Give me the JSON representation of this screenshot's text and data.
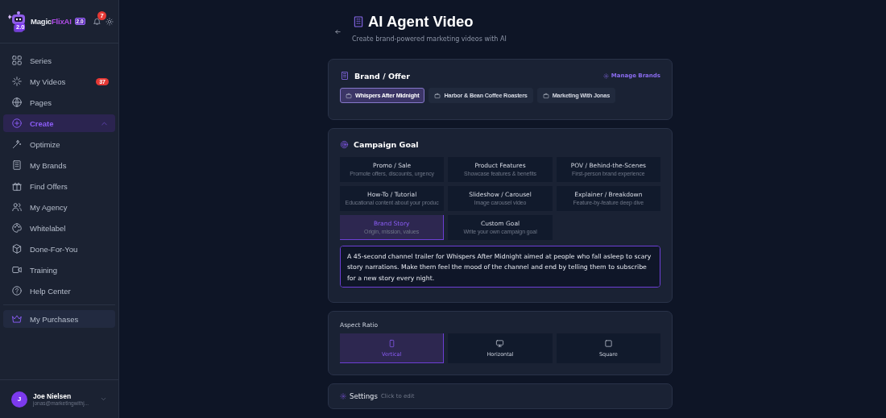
{
  "sidebar": {
    "logo": {
      "name_start": "Magic",
      "name_accent": "FlixAI",
      "version": "2.0",
      "robot_badge": "2.0"
    },
    "notification_count": "7",
    "items": [
      {
        "label": "Series",
        "selected": false
      },
      {
        "label": "My Videos",
        "selected": false,
        "badge": "37"
      },
      {
        "label": "Pages",
        "selected": false
      },
      {
        "label": "Create",
        "selected": true,
        "kind": "group",
        "expanded": true
      },
      {
        "label": "Optimize",
        "selected": false
      },
      {
        "label": "My Brands",
        "selected": false
      },
      {
        "label": "Find Offers",
        "selected": false
      },
      {
        "label": "My Agency",
        "selected": false
      },
      {
        "label": "Whitelabel",
        "selected": false
      },
      {
        "label": "Done-For-You",
        "selected": false
      },
      {
        "label": "Training",
        "selected": false
      },
      {
        "label": "Help Center",
        "selected": false
      }
    ],
    "purchases": {
      "label": "My Purchases"
    },
    "user": {
      "initial": "J",
      "name": "Joe Nielsen",
      "email": "jonas@marketingwithj..."
    }
  },
  "header": {
    "title": "AI Agent Video",
    "subtitle": "Create brand-powered marketing videos with AI"
  },
  "brand_card": {
    "title": "Brand / Offer",
    "action": "Manage Brands",
    "brands": [
      {
        "label": "Whispers After Midnight",
        "selected": true
      },
      {
        "label": "Harbor & Bean Coffee Roasters",
        "selected": false
      },
      {
        "label": "Marketing With Jonas",
        "selected": false
      }
    ]
  },
  "goal_card": {
    "title": "Campaign Goal",
    "goals": [
      {
        "title": "Promo / Sale",
        "description": "Promote offers, discounts, urgency",
        "selected": false
      },
      {
        "title": "Product Features",
        "description": "Showcase features & benefits",
        "selected": false
      },
      {
        "title": "POV / Behind-the-Scenes",
        "description": "First-person brand experience",
        "selected": false
      },
      {
        "title": "How-To / Tutorial",
        "description": "Educational content about your produc",
        "selected": false
      },
      {
        "title": "Slideshow / Carousel",
        "description": "Image carousel video",
        "selected": false
      },
      {
        "title": "Explainer / Breakdown",
        "description": "Feature-by-feature deep dive",
        "selected": false
      },
      {
        "title": "Brand Story",
        "description": "Origin, mission, values",
        "selected": true
      },
      {
        "title": "Custom Goal",
        "description": "Write your own campaign goal",
        "selected": false
      }
    ],
    "prompt": "A 45-second channel trailer for Whispers After Midnight aimed at people who fall asleep to scary story narrations. Make them feel the mood of the channel and end by telling them to subscribe for a new story every night."
  },
  "aspect_card": {
    "title": "Aspect Ratio",
    "options": [
      {
        "label": "Vertical",
        "selected": true
      },
      {
        "label": "Horizontal",
        "selected": false
      },
      {
        "label": "Square",
        "selected": false
      }
    ]
  },
  "settings_card": {
    "title": "Settings",
    "hint": "Click to edit"
  }
}
